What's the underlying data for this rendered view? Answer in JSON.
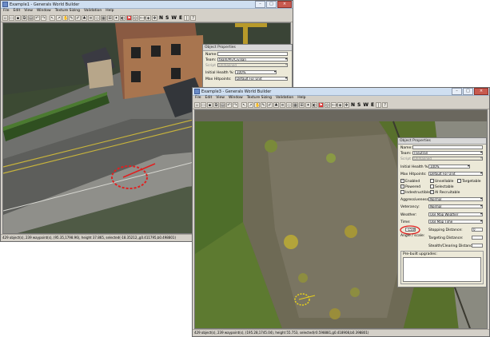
{
  "window1": {
    "title": "Example1 - Generals World Builder",
    "menu": [
      "File",
      "Edit",
      "View",
      "Window",
      "Texture Sizing",
      "Validation",
      "Help"
    ],
    "compass": [
      "N",
      "S",
      "W",
      "E"
    ],
    "status": "429 object(s), 239 waypoint(s), (95.35,1798.96), height 37.865, selected(-18.35212,,g0.411795,b0.498801)",
    "props": {
      "title": "Object Properties",
      "name_label": "Name:",
      "name_value": "",
      "team_label": "Team:",
      "team_value": "team/PlyrCivilian",
      "script_label": "Script",
      "script_value": "Unmanned",
      "health_label": "Initial Health %:",
      "health_value": "100%",
      "hitpoints_label": "Max Hitpoints:",
      "hitpoints_value": "Default For Unit"
    }
  },
  "window2": {
    "title": "Example3 - Generals World Builder",
    "menu": [
      "File",
      "Edit",
      "View",
      "Window",
      "Texture Sizing",
      "Validation",
      "Help"
    ],
    "compass": [
      "N",
      "S",
      "W",
      "E"
    ],
    "status": "429 object(s), 239 waypoint(s), (195.28,1745.04), height 55.753, selected(r0.598881,g0.418908,b0.398801)",
    "props": {
      "title": "Object Properties",
      "name_label": "Name:",
      "name_value": "",
      "team_label": "Team:",
      "team_value": "(neutral)",
      "script_label": "Script",
      "script_value": "Unmanned",
      "health_label": "Initial Health %:",
      "health_value": "100%",
      "hitpoints_label": "Max Hitpoints:",
      "hitpoints_value": "Default For Unit",
      "checks": [
        {
          "label": "Enabled",
          "checked": "✓"
        },
        {
          "label": "Unsellable",
          "checked": ""
        },
        {
          "label": "Targetable",
          "checked": ""
        },
        {
          "label": "Powered",
          "checked": "✓"
        },
        {
          "label": "Selectable",
          "checked": ""
        },
        {
          "label": "Indestructible",
          "checked": ""
        },
        {
          "label": "AI Recruitable",
          "checked": "✓"
        }
      ],
      "aggressiveness_label": "Aggressiveness:",
      "aggressiveness_value": "Normal",
      "veterancy_label": "Veterancy:",
      "veterancy_value": "Normal",
      "weather_label": "Weather:",
      "weather_value": "Use Map Weather",
      "time_label": "Time:",
      "time_value": "Use Map Time",
      "angle_value": "-1500",
      "angle_label": "Angle / scale:",
      "stopping_label": "Stopping Distance:",
      "stopping_value": "0",
      "targeting_label": "Targeting Distance:",
      "stealth_label": "Stealth/Clearing Distance:",
      "prebuilt_label": "Pre-built upgrades:"
    }
  },
  "colors": {
    "highlight_red": "#e02020",
    "highlight_yellow": "#e8d21a"
  }
}
